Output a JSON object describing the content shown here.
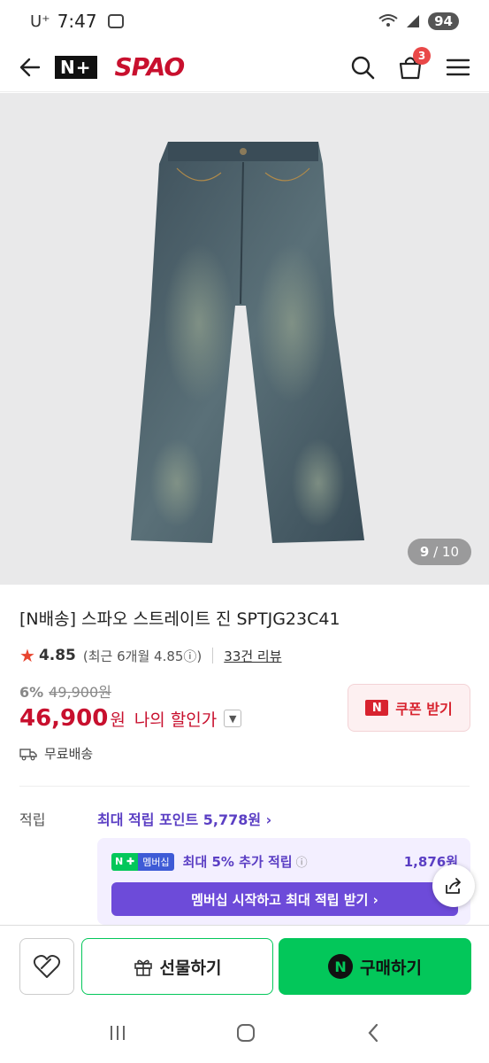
{
  "status_bar": {
    "carrier": "U⁺",
    "time": "7:47",
    "battery": "94"
  },
  "header": {
    "nplus_logo": "N+",
    "brand_logo": "SPAO",
    "cart_count": "3"
  },
  "gallery": {
    "current": "9",
    "total": "/ 10"
  },
  "product": {
    "title": "[N배송] 스파오 스트레이트 진 SPTJG23C41",
    "rating": "4.85",
    "recent_rating": "(최근 6개월 4.85ⓘ)",
    "reviews": "33건 리뷰",
    "discount_pct": "6%",
    "original_price": "49,900원",
    "price": "46,900",
    "price_unit": "원",
    "price_label": "나의 할인가",
    "coupon_label": "쿠폰 받기",
    "coupon_icon": "N",
    "shipping": "무료배송"
  },
  "points": {
    "label": "적립",
    "max_points": "최대 적립 포인트 5,778원 ›",
    "membership_logo_a": "N ✚",
    "membership_logo_b": "멤버십",
    "extra": "최대 5% 추가 적립",
    "extra_info": "ⓘ",
    "extra_amount": "1,876원",
    "membership_button": "멤버십 시작하고 최대 적립 받기 ›"
  },
  "bottom_bar": {
    "gift_label": "선물하기",
    "buy_label": "구매하기",
    "buy_icon": "N"
  },
  "colors": {
    "brand_red": "#c8102e",
    "naver_green": "#03c75a",
    "membership_purple": "#6d4bd9"
  }
}
